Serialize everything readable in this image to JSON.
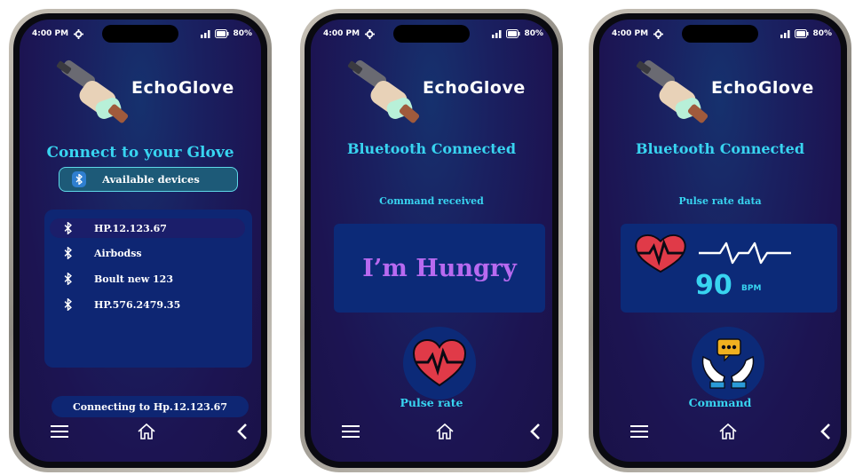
{
  "status": {
    "time": "4:00 PM",
    "battery": "80%"
  },
  "app_name": "EchoGlove",
  "colors": {
    "accent": "#38d4f0",
    "background": "#1c1452",
    "card": "#0c2a78",
    "command_text": "#b86af0",
    "heart": "#e03a48"
  },
  "screen1": {
    "title": "Connect to your Glove",
    "available_label": "Available devices",
    "devices": [
      {
        "name": "HP.12.123.67",
        "selected": true
      },
      {
        "name": "Airbodss",
        "selected": false
      },
      {
        "name": "Boult new 123",
        "selected": false
      },
      {
        "name": "HP.576.2479.35",
        "selected": false
      }
    ],
    "connecting": "Connecting to Hp.12.123.67"
  },
  "screen2": {
    "title": "Bluetooth Connected",
    "subtitle": "Command received",
    "command": "I’m Hungry",
    "action_label": "Pulse rate"
  },
  "screen3": {
    "title": "Bluetooth Connected",
    "subtitle": "Pulse rate data",
    "bpm_value": "90",
    "bpm_unit": "BPM",
    "action_label": "Command"
  },
  "icons": [
    "settings-icon",
    "signal-icon",
    "battery-icon",
    "bluetooth-icon",
    "menu-icon",
    "home-icon",
    "back-icon",
    "heart-pulse-icon",
    "chat-hands-icon",
    "logo-icon"
  ]
}
